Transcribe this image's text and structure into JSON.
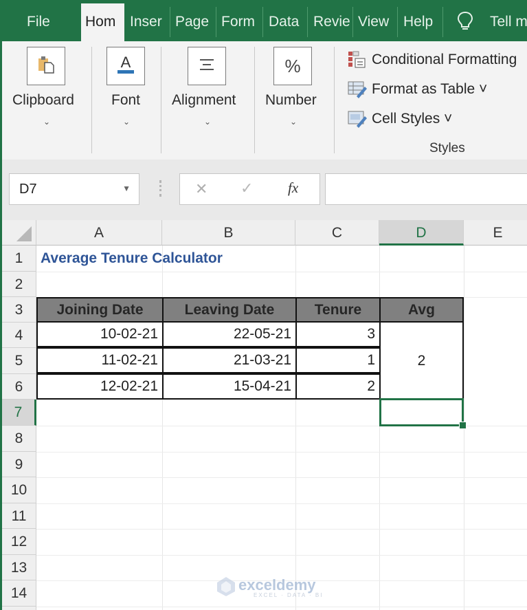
{
  "ribbon": {
    "tabs": [
      {
        "label": "File",
        "active": false
      },
      {
        "label": "Hom",
        "active": true
      },
      {
        "label": "Inser",
        "active": false
      },
      {
        "label": "Page",
        "active": false
      },
      {
        "label": "Form",
        "active": false
      },
      {
        "label": "Data",
        "active": false
      },
      {
        "label": "Revie",
        "active": false
      },
      {
        "label": "View",
        "active": false
      },
      {
        "label": "Help",
        "active": false
      }
    ],
    "tell_me": "Tell m",
    "tell_me_icon": "lightbulb-icon",
    "groups": [
      {
        "label": "Clipboard",
        "icon": "clipboard-icon"
      },
      {
        "label": "Font",
        "icon": "font-color-icon"
      },
      {
        "label": "Alignment",
        "icon": "align-center-icon"
      },
      {
        "label": "Number",
        "icon": "percent-icon",
        "glyph": "%"
      }
    ],
    "styles": {
      "items": [
        {
          "label": "Conditional Formatting",
          "icon": "conditional-formatting-icon"
        },
        {
          "label": "Format as Table ˅",
          "icon": "format-as-table-icon"
        },
        {
          "label": "Cell Styles ˅",
          "icon": "cell-styles-icon"
        }
      ],
      "group_label": "Styles"
    },
    "accent": "#217346"
  },
  "formula_bar": {
    "name_box": "D7",
    "cancel": "✕",
    "enter": "✓",
    "fx": "fx",
    "formula": ""
  },
  "sheet": {
    "columns": [
      "A",
      "B",
      "C",
      "D",
      "E"
    ],
    "selected_column": "D",
    "rows": [
      "1",
      "2",
      "3",
      "4",
      "5",
      "6",
      "7",
      "8",
      "9",
      "10",
      "11",
      "12",
      "13",
      "14"
    ],
    "selected_row": "7",
    "title": "Average Tenure Calculator",
    "title_color": "#2f5597",
    "table": {
      "headers": [
        "Joining Date",
        "Leaving Date",
        "Tenure",
        "Avg"
      ],
      "rows": [
        [
          "10-02-21",
          "22-05-21",
          "3"
        ],
        [
          "11-02-21",
          "21-03-21",
          "1"
        ],
        [
          "12-02-21",
          "15-04-21",
          "2"
        ]
      ],
      "avg_value": "2"
    },
    "active_cell": "D7"
  },
  "watermark": {
    "name": "exceldemy",
    "sub": "EXCEL · DATA · BI"
  }
}
